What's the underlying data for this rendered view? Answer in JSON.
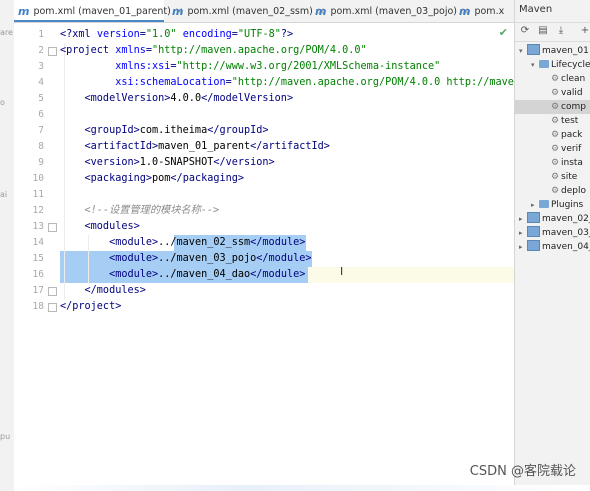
{
  "left_strip": {
    "labels": [
      "are",
      "o",
      "ai",
      "pu"
    ]
  },
  "tabs": [
    {
      "label": "pom.xml (maven_01_parent)",
      "close": "×",
      "active": true
    },
    {
      "label": "pom.xml (maven_02_ssm)",
      "close": "×",
      "active": false
    },
    {
      "label": "pom.xml (maven_03_pojo)",
      "close": "×",
      "active": false
    },
    {
      "label": "pom.x",
      "close": "",
      "active": false
    }
  ],
  "tab_icon": "m",
  "editor": {
    "status_check": "✔",
    "lines": [
      {
        "num": "1",
        "parts": [
          [
            "tag",
            "<?xml "
          ],
          [
            "attr",
            "version"
          ],
          [
            "tag",
            "="
          ],
          [
            "val",
            "\"1.0\""
          ],
          [
            "tag",
            " "
          ],
          [
            "attr",
            "encoding"
          ],
          [
            "tag",
            "="
          ],
          [
            "val",
            "\"UTF-8\""
          ],
          [
            "tag",
            "?>"
          ]
        ]
      },
      {
        "num": "2",
        "parts": [
          [
            "tag",
            "<project "
          ],
          [
            "attr",
            "xmlns"
          ],
          [
            "tag",
            "="
          ],
          [
            "val",
            "\"http://maven.apache.org/POM/4.0.0\""
          ]
        ]
      },
      {
        "num": "3",
        "parts": [
          [
            "tag",
            "         "
          ],
          [
            "attr",
            "xmlns:xsi"
          ],
          [
            "tag",
            "="
          ],
          [
            "val",
            "\"http://www.w3.org/2001/XMLSchema-instance\""
          ]
        ]
      },
      {
        "num": "4",
        "parts": [
          [
            "tag",
            "         "
          ],
          [
            "attr",
            "xsi:schemaLocation"
          ],
          [
            "tag",
            "="
          ],
          [
            "val",
            "\"http://maven.apache.org/POM/4.0.0 http://mave"
          ]
        ]
      },
      {
        "num": "5",
        "parts": [
          [
            "tag",
            "    <modelVersion>"
          ],
          [
            "text",
            "4.0.0"
          ],
          [
            "tag",
            "</modelVersion>"
          ]
        ]
      },
      {
        "num": "6",
        "parts": []
      },
      {
        "num": "7",
        "parts": [
          [
            "tag",
            "    <groupId>"
          ],
          [
            "text",
            "com.itheima"
          ],
          [
            "tag",
            "</groupId>"
          ]
        ]
      },
      {
        "num": "8",
        "parts": [
          [
            "tag",
            "    <artifactId>"
          ],
          [
            "text",
            "maven_01_parent"
          ],
          [
            "tag",
            "</artifactId>"
          ]
        ]
      },
      {
        "num": "9",
        "parts": [
          [
            "tag",
            "    <version>"
          ],
          [
            "text",
            "1.0-SNAPSHOT"
          ],
          [
            "tag",
            "</version>"
          ]
        ]
      },
      {
        "num": "10",
        "parts": [
          [
            "tag",
            "    <packaging>"
          ],
          [
            "text",
            "pom"
          ],
          [
            "tag",
            "</packaging>"
          ]
        ]
      },
      {
        "num": "11",
        "parts": []
      },
      {
        "num": "12",
        "parts": [
          [
            "cmt",
            "    <!--设置管理的模块名称-->"
          ]
        ]
      },
      {
        "num": "13",
        "parts": [
          [
            "tag",
            "    <modules>"
          ]
        ]
      },
      {
        "num": "14",
        "parts": [
          [
            "tag",
            "        <module>"
          ],
          [
            "text",
            "../maven_02_ssm"
          ],
          [
            "tag",
            "</module>"
          ]
        ]
      },
      {
        "num": "15",
        "parts": [
          [
            "tag",
            "        <module>"
          ],
          [
            "text",
            "../maven_03_pojo"
          ],
          [
            "tag",
            "</module>"
          ]
        ]
      },
      {
        "num": "16",
        "parts": [
          [
            "tag",
            "        <module>"
          ],
          [
            "text",
            "../maven_04_dao"
          ],
          [
            "tag",
            "</module>"
          ]
        ]
      },
      {
        "num": "17",
        "parts": [
          [
            "tag",
            "    </modules>"
          ]
        ]
      },
      {
        "num": "18",
        "parts": [
          [
            "tag",
            "</project>"
          ]
        ]
      }
    ]
  },
  "maven_panel": {
    "title": "Maven",
    "toolbar_icons": [
      "refresh-icon",
      "add-project-icon",
      "download-icon",
      "add-icon"
    ],
    "tree": [
      {
        "label": "maven_01",
        "level": 0,
        "arrow": "▾",
        "kind": "project",
        "selected": false
      },
      {
        "label": "Lifecycle",
        "level": 1,
        "arrow": "▾",
        "kind": "folder",
        "selected": false
      },
      {
        "label": "clean",
        "level": 2,
        "arrow": "",
        "kind": "goal",
        "selected": false
      },
      {
        "label": "valid",
        "level": 2,
        "arrow": "",
        "kind": "goal",
        "selected": false
      },
      {
        "label": "comp",
        "level": 2,
        "arrow": "",
        "kind": "goal",
        "selected": true
      },
      {
        "label": "test",
        "level": 2,
        "arrow": "",
        "kind": "goal",
        "selected": false
      },
      {
        "label": "pack",
        "level": 2,
        "arrow": "",
        "kind": "goal",
        "selected": false
      },
      {
        "label": "verif",
        "level": 2,
        "arrow": "",
        "kind": "goal",
        "selected": false
      },
      {
        "label": "insta",
        "level": 2,
        "arrow": "",
        "kind": "goal",
        "selected": false
      },
      {
        "label": "site",
        "level": 2,
        "arrow": "",
        "kind": "goal",
        "selected": false
      },
      {
        "label": "deplo",
        "level": 2,
        "arrow": "",
        "kind": "goal",
        "selected": false
      },
      {
        "label": "Plugins",
        "level": 1,
        "arrow": "▸",
        "kind": "folder",
        "selected": false
      },
      {
        "label": "maven_02_",
        "level": 0,
        "arrow": "▸",
        "kind": "project",
        "selected": false
      },
      {
        "label": "maven_03_",
        "level": 0,
        "arrow": "▸",
        "kind": "project",
        "selected": false
      },
      {
        "label": "maven_04_",
        "level": 0,
        "arrow": "▸",
        "kind": "project",
        "selected": false
      }
    ]
  },
  "watermark": "CSDN @客院载论",
  "colors": {
    "selection": "#a6cdf3",
    "tag": "#000080",
    "attr": "#0000ff",
    "value": "#008000",
    "comment": "#8c8c8c",
    "tab_underline": "#4a88c7"
  }
}
